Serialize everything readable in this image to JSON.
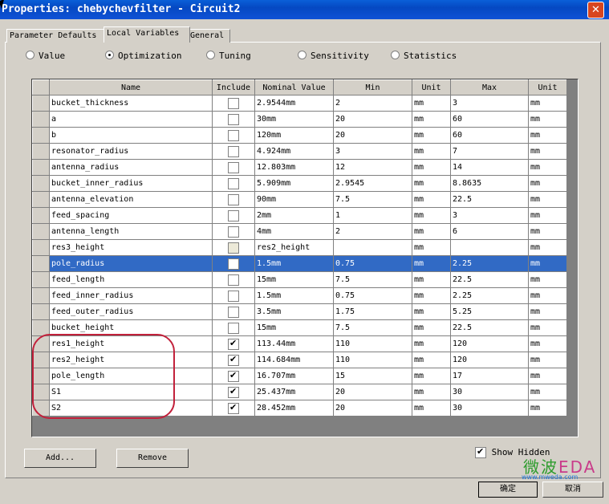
{
  "window": {
    "title": "Properties: chebychevfilter - Circuit2",
    "close_glyph": "✕"
  },
  "tabs": [
    "Parameter Defaults",
    "Local Variables",
    "General"
  ],
  "active_tab": 1,
  "radio": {
    "options": [
      "Value",
      "Optimization",
      "Tuning",
      "Sensitivity",
      "Statistics"
    ],
    "selected": 1
  },
  "table": {
    "columns": [
      "Name",
      "Include",
      "Nominal Value",
      "Min",
      "Unit",
      "Max",
      "Unit"
    ],
    "highlighted_row": 10,
    "rows": [
      {
        "name": "bucket_thickness",
        "include": false,
        "nominal": "2.9544mm",
        "min": "2",
        "unit1": "mm",
        "max": "3",
        "unit2": "mm"
      },
      {
        "name": "a",
        "include": false,
        "nominal": "30mm",
        "min": "20",
        "unit1": "mm",
        "max": "60",
        "unit2": "mm"
      },
      {
        "name": "b",
        "include": false,
        "nominal": "120mm",
        "min": "20",
        "unit1": "mm",
        "max": "60",
        "unit2": "mm"
      },
      {
        "name": "resonator_radius",
        "include": false,
        "nominal": "4.924mm",
        "min": "3",
        "unit1": "mm",
        "max": "7",
        "unit2": "mm"
      },
      {
        "name": "antenna_radius",
        "include": false,
        "nominal": "12.803mm",
        "min": "12",
        "unit1": "mm",
        "max": "14",
        "unit2": "mm"
      },
      {
        "name": "bucket_inner_radius",
        "include": false,
        "nominal": "5.909mm",
        "min": "2.9545",
        "unit1": "mm",
        "max": "8.8635",
        "unit2": "mm"
      },
      {
        "name": "antenna_elevation",
        "include": false,
        "nominal": "90mm",
        "min": "7.5",
        "unit1": "mm",
        "max": "22.5",
        "unit2": "mm"
      },
      {
        "name": "feed_spacing",
        "include": false,
        "nominal": "2mm",
        "min": "1",
        "unit1": "mm",
        "max": "3",
        "unit2": "mm"
      },
      {
        "name": "antenna_length",
        "include": false,
        "nominal": "4mm",
        "min": "2",
        "unit1": "mm",
        "max": "6",
        "unit2": "mm"
      },
      {
        "name": "res3_height",
        "include": false,
        "disabled": true,
        "nominal": "res2_height",
        "min": "",
        "unit1": "mm",
        "max": "",
        "unit2": "mm"
      },
      {
        "name": "pole_radius",
        "include": false,
        "nominal": "1.5mm",
        "min": "0.75",
        "unit1": "mm",
        "max": "2.25",
        "unit2": "mm"
      },
      {
        "name": "feed_length",
        "include": false,
        "nominal": "15mm",
        "min": "7.5",
        "unit1": "mm",
        "max": "22.5",
        "unit2": "mm"
      },
      {
        "name": "feed_inner_radius",
        "include": false,
        "nominal": "1.5mm",
        "min": "0.75",
        "unit1": "mm",
        "max": "2.25",
        "unit2": "mm"
      },
      {
        "name": "feed_outer_radius",
        "include": false,
        "nominal": "3.5mm",
        "min": "1.75",
        "unit1": "mm",
        "max": "5.25",
        "unit2": "mm"
      },
      {
        "name": "bucket_height",
        "include": false,
        "nominal": "15mm",
        "min": "7.5",
        "unit1": "mm",
        "max": "22.5",
        "unit2": "mm"
      },
      {
        "name": "res1_height",
        "include": true,
        "nominal": "113.44mm",
        "min": "110",
        "unit1": "mm",
        "max": "120",
        "unit2": "mm"
      },
      {
        "name": "res2_height",
        "include": true,
        "nominal": "114.684mm",
        "min": "110",
        "unit1": "mm",
        "max": "120",
        "unit2": "mm"
      },
      {
        "name": "pole_length",
        "include": true,
        "nominal": "16.707mm",
        "min": "15",
        "unit1": "mm",
        "max": "17",
        "unit2": "mm"
      },
      {
        "name": "S1",
        "include": true,
        "nominal": "25.437mm",
        "min": "20",
        "unit1": "mm",
        "max": "30",
        "unit2": "mm"
      },
      {
        "name": "S2",
        "include": true,
        "nominal": "28.452mm",
        "min": "20",
        "unit1": "mm",
        "max": "30",
        "unit2": "mm"
      }
    ]
  },
  "buttons": {
    "add": "Add...",
    "remove": "Remove",
    "ok": "确定",
    "cancel": "取消"
  },
  "show_hidden": {
    "label": "Show Hidden",
    "checked": true
  },
  "watermark": {
    "text_cn": "微波",
    "text_en": "EDA",
    "url": "www.mweda.com"
  },
  "colors": {
    "titlebar": "#0548c2",
    "selection": "#316ac5",
    "annotation": "#c2213b"
  }
}
